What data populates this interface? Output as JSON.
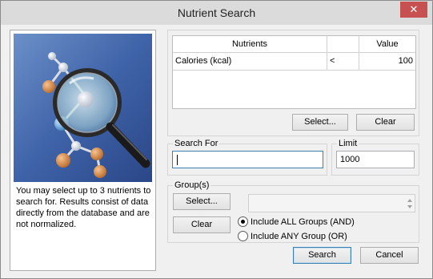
{
  "window": {
    "title": "Nutrient Search",
    "close_glyph": "✕"
  },
  "info": {
    "text": "You may select up to 3 nutrients to search for. Results consist of data directly from the database and are not normalized."
  },
  "nutrients": {
    "columns": [
      "Nutrients",
      "",
      "Value"
    ],
    "rows": [
      {
        "nutrient": "Calories (kcal)",
        "operator": "<",
        "value": "100"
      }
    ],
    "select_label": "Select...",
    "clear_label": "Clear"
  },
  "search_for": {
    "label": "Search For",
    "value": ""
  },
  "limit": {
    "label": "Limit",
    "value": "1000"
  },
  "groups": {
    "label": "Group(s)",
    "select_label": "Select...",
    "clear_label": "Clear",
    "options": [
      {
        "label": "Include ALL Groups (AND)",
        "checked": true
      },
      {
        "label": "Include ANY Group (OR)",
        "checked": false
      }
    ]
  },
  "footer": {
    "search_label": "Search",
    "cancel_label": "Cancel"
  },
  "icons": {
    "hero": "magnifying-glass-molecules-icon"
  }
}
